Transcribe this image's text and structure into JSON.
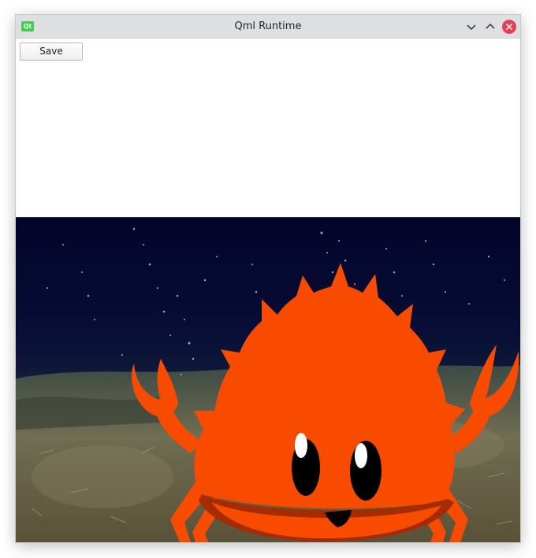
{
  "window": {
    "title": "Qml Runtime",
    "app_icon_text": "Qt"
  },
  "toolbar": {
    "save_label": "Save"
  },
  "image": {
    "description_icon": "ferris-crab-icon",
    "background": "deep-sea-floor-photo"
  },
  "colors": {
    "crab": "#f74c00",
    "crab_dark": "#a52b00",
    "water": "#060a2e",
    "seabed": "#6e6a4e",
    "close_button": "#e0405a",
    "qt_green": "#41cd52"
  }
}
